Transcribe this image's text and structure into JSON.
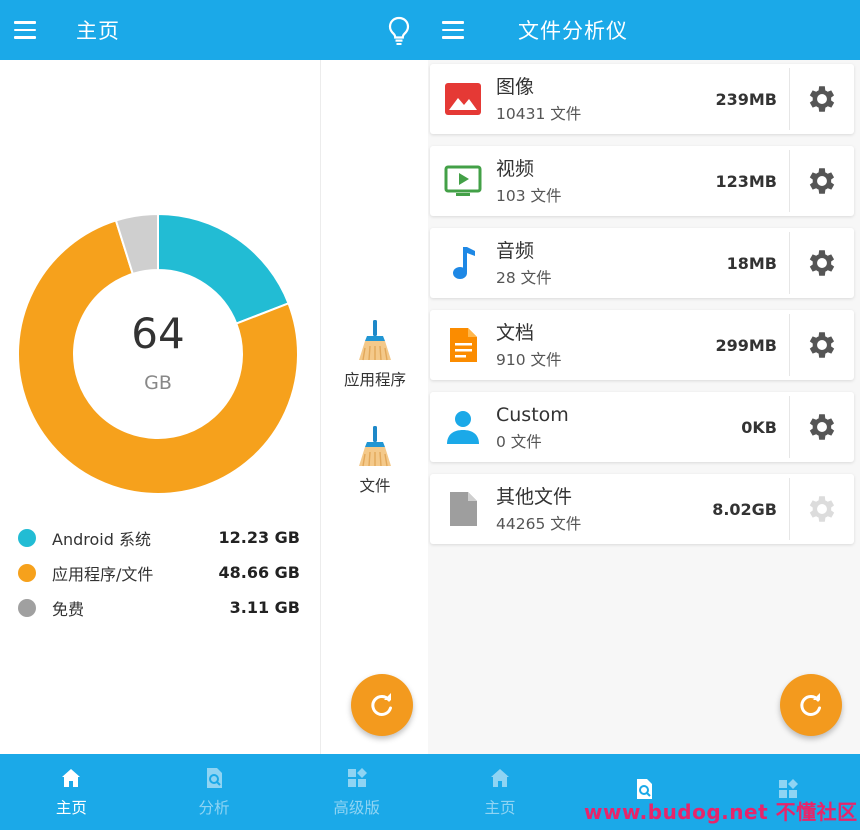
{
  "colors": {
    "primary": "#1ba9e8",
    "android": "#22bcd4",
    "apps": "#f6a11c",
    "free": "#cfcfcf",
    "fab": "#f39a1e"
  },
  "left": {
    "header": {
      "title": "主页"
    },
    "storage": {
      "total": "64",
      "unit": "GB"
    },
    "legend": [
      {
        "label": "Android 系统",
        "value": "12.23 GB",
        "color": "#22bcd4"
      },
      {
        "label": "应用程序/文件",
        "value": "48.66 GB",
        "color": "#f6a11c"
      },
      {
        "label": "免费",
        "value": "3.11 GB",
        "color": "#a0a0a0"
      }
    ],
    "clean_items": [
      {
        "label": "应用程序"
      },
      {
        "label": "文件"
      }
    ],
    "nav": [
      {
        "label": "主页"
      },
      {
        "label": "分析"
      },
      {
        "label": "高级版"
      }
    ]
  },
  "right": {
    "header": {
      "title": "文件分析仪"
    },
    "categories": [
      {
        "name": "图像",
        "count": "10431 文件",
        "size": "239MB",
        "icon": "image-icon",
        "color": "#e53935"
      },
      {
        "name": "视频",
        "count": "103 文件",
        "size": "123MB",
        "icon": "video-icon",
        "color": "#43a047"
      },
      {
        "name": "音频",
        "count": "28 文件",
        "size": "18MB",
        "icon": "music-note-icon",
        "color": "#1e88e5"
      },
      {
        "name": "文档",
        "count": "910 文件",
        "size": "299MB",
        "icon": "document-icon",
        "color": "#fb8c00"
      },
      {
        "name": "Custom",
        "count": "0 文件",
        "size": "0KB",
        "icon": "person-icon",
        "color": "#1ba9e8"
      },
      {
        "name": "其他文件",
        "count": "44265 文件",
        "size": "8.02GB",
        "icon": "file-icon",
        "color": "#9e9e9e"
      }
    ],
    "nav": [
      {
        "label": "主页"
      }
    ]
  },
  "watermark": "www.budog.net 不懂社区"
}
